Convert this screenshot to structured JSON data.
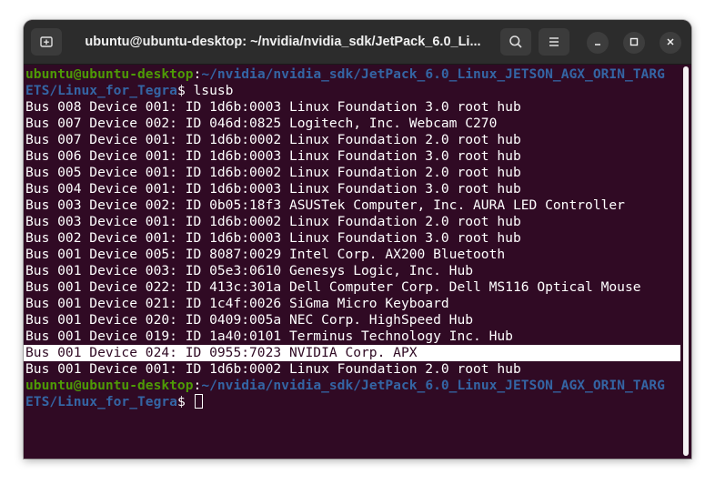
{
  "window": {
    "title": "ubuntu@ubuntu-desktop: ~/nvidia/nvidia_sdk/JetPack_6.0_Li..."
  },
  "toolbar": {
    "new_tab_icon": "new-tab-icon",
    "search_icon": "search-icon",
    "menu_icon": "hamburger-menu-icon",
    "minimize_icon": "minimize-icon",
    "maximize_icon": "maximize-icon",
    "close_icon": "close-icon"
  },
  "colors": {
    "terminal_bg": "#300a24",
    "prompt_user": "#4e9a06",
    "prompt_path": "#3465a4",
    "text": "#ffffff"
  },
  "prompt": {
    "user_host": "ubuntu@ubuntu-desktop",
    "separator": ":",
    "path_part1": "~/nvidia/nvidia_sdk/JetPack_6.0_Linux_JETSON_AGX_ORIN_TARG",
    "path_part2": "ETS/Linux_for_Tegra",
    "symbol": "$ "
  },
  "command": "lsusb",
  "output": [
    "Bus 008 Device 001: ID 1d6b:0003 Linux Foundation 3.0 root hub",
    "Bus 007 Device 002: ID 046d:0825 Logitech, Inc. Webcam C270",
    "Bus 007 Device 001: ID 1d6b:0002 Linux Foundation 2.0 root hub",
    "Bus 006 Device 001: ID 1d6b:0003 Linux Foundation 3.0 root hub",
    "Bus 005 Device 001: ID 1d6b:0002 Linux Foundation 2.0 root hub",
    "Bus 004 Device 001: ID 1d6b:0003 Linux Foundation 3.0 root hub",
    "Bus 003 Device 002: ID 0b05:18f3 ASUSTek Computer, Inc. AURA LED Controller",
    "Bus 003 Device 001: ID 1d6b:0002 Linux Foundation 2.0 root hub",
    "Bus 002 Device 001: ID 1d6b:0003 Linux Foundation 3.0 root hub",
    "Bus 001 Device 005: ID 8087:0029 Intel Corp. AX200 Bluetooth",
    "Bus 001 Device 003: ID 05e3:0610 Genesys Logic, Inc. Hub",
    "Bus 001 Device 022: ID 413c:301a Dell Computer Corp. Dell MS116 Optical Mouse",
    "Bus 001 Device 021: ID 1c4f:0026 SiGma Micro Keyboard",
    "Bus 001 Device 020: ID 0409:005a NEC Corp. HighSpeed Hub",
    "Bus 001 Device 019: ID 1a40:0101 Terminus Technology Inc. Hub",
    "Bus 001 Device 024: ID 0955:7023 NVIDIA Corp. APX",
    "Bus 001 Device 001: ID 1d6b:0002 Linux Foundation 2.0 root hub"
  ],
  "selected_line_index": 15
}
